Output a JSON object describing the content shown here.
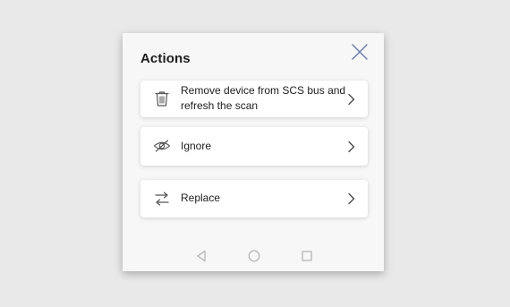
{
  "dialog": {
    "title": "Actions",
    "close_icon": "close-icon"
  },
  "actions": [
    {
      "label": "Remove device from SCS bus and refresh the scan",
      "icon": "trash-icon"
    },
    {
      "label": "Ignore",
      "icon": "eye-slash-icon"
    },
    {
      "label": "Replace",
      "icon": "swap-icon"
    }
  ],
  "navbar": {
    "items": [
      "back-icon",
      "home-icon",
      "recents-icon"
    ]
  },
  "colors": {
    "background": "#e9e9e9",
    "sheet": "#f7f7f7",
    "card": "#ffffff",
    "close_accent": "#6b7fae",
    "text": "#1d1d1d",
    "nav_icon": "#b0b0b0"
  }
}
